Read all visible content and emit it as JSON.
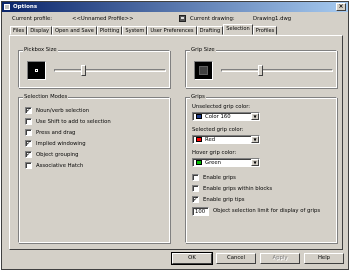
{
  "window": {
    "title": "Options",
    "close_glyph": "×"
  },
  "header": {
    "profile_label": "Current profile:",
    "profile_value": "<<Unnamed Profile>>",
    "drawing_label": "Current drawing:",
    "drawing_value": "Drawing1.dwg"
  },
  "tabs": [
    {
      "label": "Files",
      "active": false
    },
    {
      "label": "Display",
      "active": false
    },
    {
      "label": "Open and Save",
      "active": false
    },
    {
      "label": "Plotting",
      "active": false
    },
    {
      "label": "System",
      "active": false
    },
    {
      "label": "User Preferences",
      "active": false
    },
    {
      "label": "Drafting",
      "active": false
    },
    {
      "label": "Selection",
      "active": true
    },
    {
      "label": "Profiles",
      "active": false
    }
  ],
  "pickbox": {
    "title": "Pickbox Size",
    "slider_level": 0.25
  },
  "gripsize": {
    "title": "Grip Size",
    "slider_level": 0.35
  },
  "selection_modes": {
    "title": "Selection Modes",
    "items": [
      {
        "label": "Noun/verb selection",
        "checked": true
      },
      {
        "label": "Use Shift to add to selection",
        "checked": false
      },
      {
        "label": "Press and drag",
        "checked": false
      },
      {
        "label": "Implied windowing",
        "checked": true
      },
      {
        "label": "Object grouping",
        "checked": true
      },
      {
        "label": "Associative Hatch",
        "checked": false
      }
    ]
  },
  "grips": {
    "title": "Grips",
    "unselected_label": "Unselected grip color:",
    "unselected_value": "Color 160",
    "unselected_color": "#1e3c8c",
    "selected_label": "Selected grip color:",
    "selected_value": "Red",
    "selected_color": "#ff0000",
    "hover_label": "Hover grip color:",
    "hover_value": "Green",
    "hover_color": "#00c000",
    "dropdown_arrow": "▼",
    "checks": [
      {
        "label": "Enable grips",
        "checked": false
      },
      {
        "label": "Enable grips within blocks",
        "checked": false
      },
      {
        "label": "Enable grip tips",
        "checked": true
      }
    ],
    "limit_value": "100",
    "limit_label": "Object selection limit for display of grips"
  },
  "buttons": {
    "ok": "OK",
    "cancel": "Cancel",
    "apply": "Apply",
    "help": "Help"
  },
  "check_glyph": "✓"
}
